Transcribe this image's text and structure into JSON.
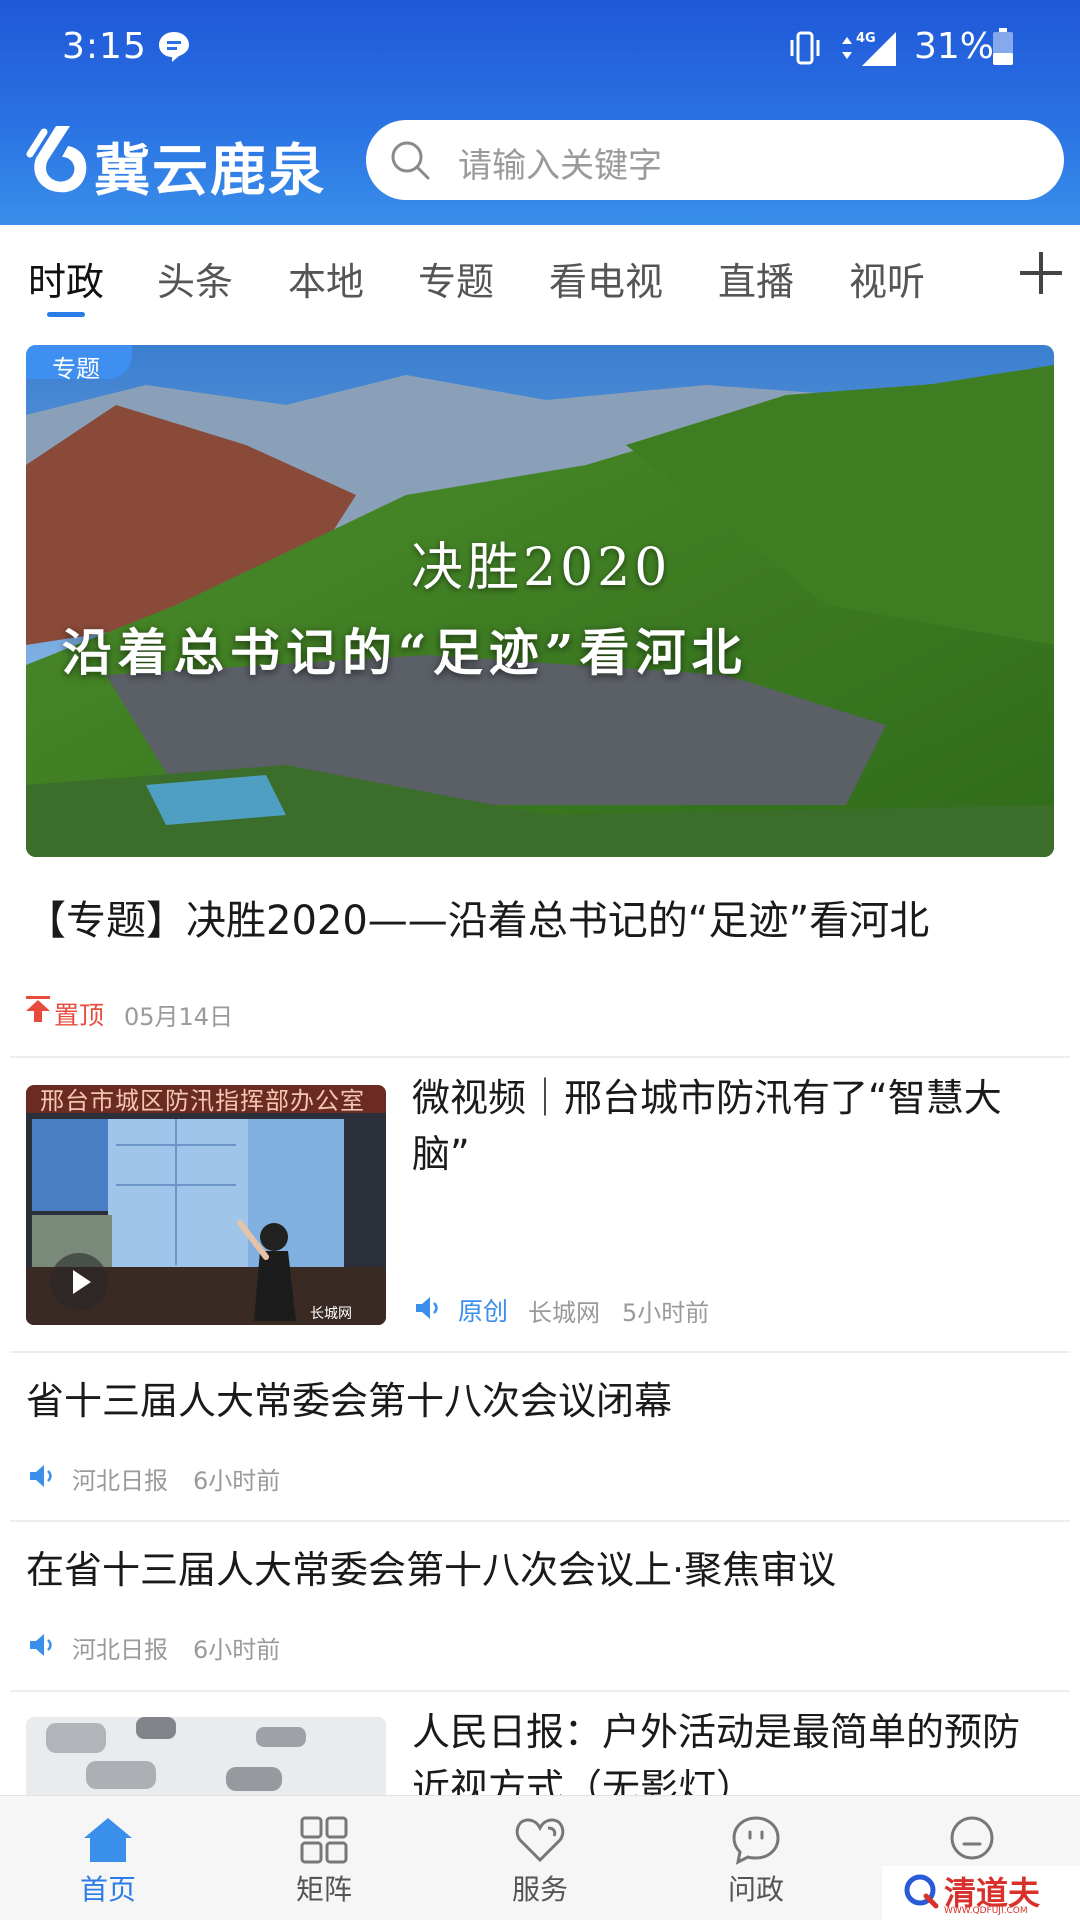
{
  "status_bar": {
    "time": "3:15",
    "network": "4G",
    "battery": "31%"
  },
  "header": {
    "app_name": "冀云鹿泉",
    "search_placeholder": "请输入关键字"
  },
  "tabs": [
    "时政",
    "头条",
    "本地",
    "专题",
    "看电视",
    "直播",
    "视听"
  ],
  "active_tab": "时政",
  "featured": {
    "badge": "专题",
    "image_caption_line1": "决胜2020",
    "image_caption_line2": "沿着总书记的“足迹”看河北",
    "title": "【专题】决胜2020——沿着总书记的“足迹”看河北",
    "pin_label": "置顶",
    "date": "05月14日"
  },
  "news": [
    {
      "title": "微视频｜邢台城市防汛有了“智慧大脑”",
      "thumb_caption": "邢台市城区防汛指挥部办公室",
      "thumb_watermark": "长城网",
      "original": "原创",
      "source": "长城网",
      "time": "5小时前"
    },
    {
      "title": "省十三届人大常委会第十八次会议闭幕",
      "source": "河北日报",
      "time": "6小时前"
    },
    {
      "title": "在省十三届人大常委会第十八次会议上·聚焦审议",
      "source": "河北日报",
      "time": "6小时前"
    },
    {
      "title": "人民日报：户外活动是最简单的预防近视方式（无影灯）"
    }
  ],
  "bottom_nav": [
    {
      "label": "首页",
      "icon": "home-icon"
    },
    {
      "label": "矩阵",
      "icon": "grid-icon"
    },
    {
      "label": "服务",
      "icon": "heart-icon"
    },
    {
      "label": "问政",
      "icon": "chat-icon"
    },
    {
      "label": "",
      "icon": "user-icon"
    }
  ],
  "watermark": {
    "text": "清道夫",
    "sub": "WWW.QDFUJI.COM"
  },
  "colors": {
    "accent": "#2a7de8",
    "pin": "#e84b3c",
    "header_top": "#1f58d8",
    "header_bottom": "#3a8fea"
  }
}
